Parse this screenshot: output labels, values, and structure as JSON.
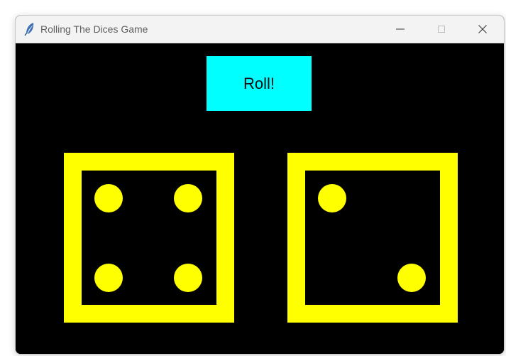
{
  "window": {
    "title": "Rolling The Dices Game",
    "icon": "feather-icon",
    "controls": [
      "minimize-icon",
      "maximize-icon",
      "close-icon"
    ]
  },
  "game": {
    "roll_label": "Roll!",
    "dice": [
      {
        "value": 4
      },
      {
        "value": 2
      }
    ]
  },
  "colors": {
    "background": "#000000",
    "roll_button": "#00ffff",
    "die": "#ffff00",
    "pip": "#ffff00",
    "titlebar": "#f3f3f3"
  }
}
